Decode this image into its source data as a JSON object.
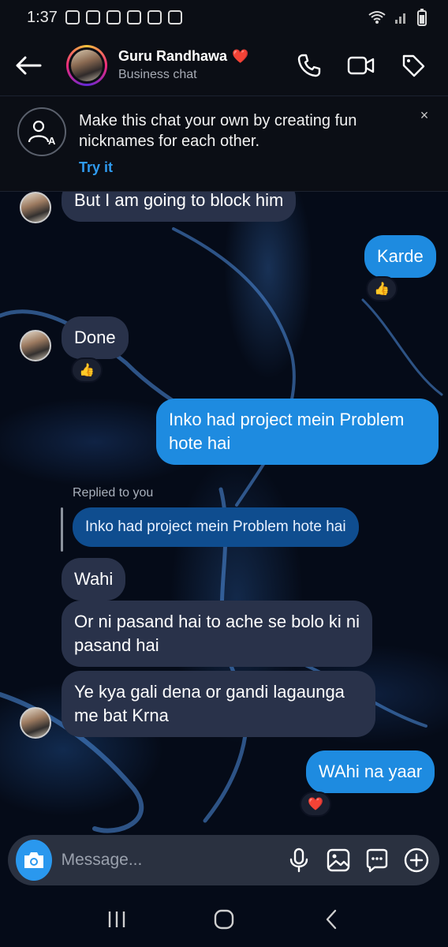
{
  "status_bar": {
    "time": "1:37"
  },
  "header": {
    "name": "Guru Randhawa",
    "name_emoji": "❤️",
    "subtitle": "Business chat",
    "icons": [
      "back-arrow-icon",
      "phone-icon",
      "video-camera-icon",
      "tag-icon"
    ]
  },
  "banner": {
    "text": "Make this chat your own by creating fun nicknames for each other.",
    "link": "Try it",
    "close": "×"
  },
  "messages": {
    "m1": "But I am going to block him",
    "m2": "Karde",
    "m2_reaction": "👍",
    "m3": "Done",
    "m3_reaction": "👍",
    "m4": "Inko had project mein Problem hote hai",
    "reply_label": "Replied to you",
    "reply_quote": "Inko had project mein Problem hote hai",
    "m5": "Wahi",
    "m6": "Or ni pasand hai to ache se bolo ki ni pasand hai",
    "m7": "Ye kya gali dena or gandi lagaunga me bat Krna",
    "m8": "WAhi na yaar",
    "m8_reaction": "❤️"
  },
  "composer": {
    "placeholder": "Message...",
    "icons": [
      "camera-icon",
      "microphone-icon",
      "gallery-icon",
      "sticker-icon",
      "plus-icon"
    ]
  },
  "colors": {
    "accent": "#1e8be0",
    "incoming_bubble": "#29324a",
    "reply_bubble": "#0f4d8f",
    "link": "#2f9bf0"
  }
}
